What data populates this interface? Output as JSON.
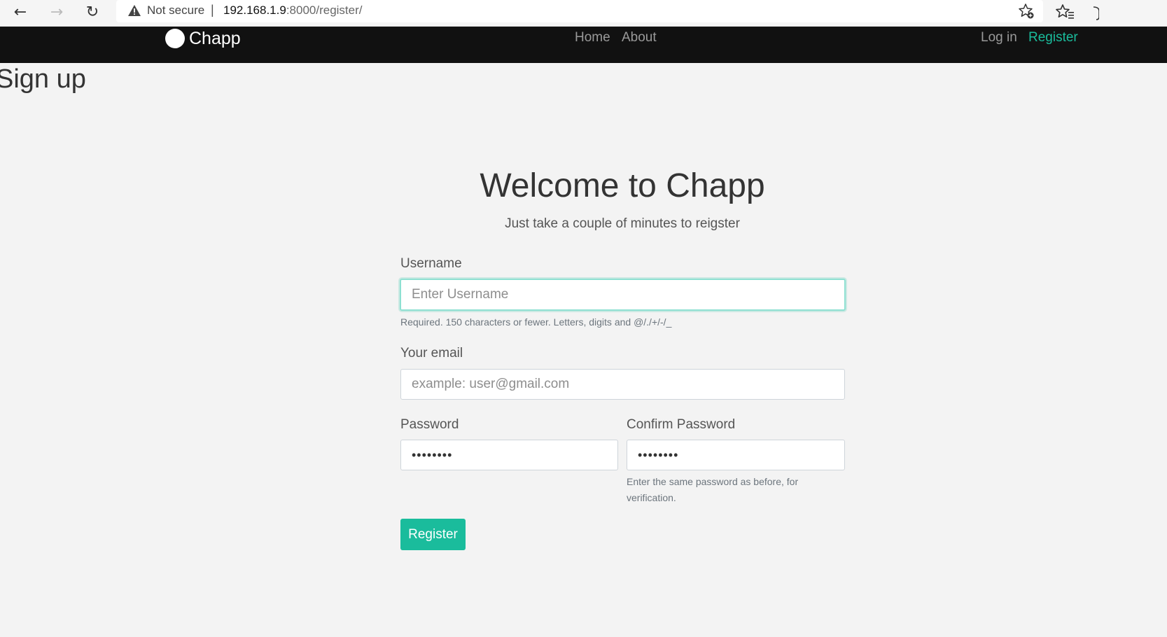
{
  "browser": {
    "back_glyph": "←",
    "forward_glyph": "→",
    "reload_glyph": "↻",
    "security_label": "Not secure",
    "url_separator": "|",
    "url_host": "192.168.1.9",
    "url_path": ":8000/register/"
  },
  "navbar": {
    "brand": "Chapp",
    "links": [
      {
        "label": "Home"
      },
      {
        "label": "About"
      }
    ],
    "auth": {
      "login": "Log in",
      "register": "Register"
    },
    "colors": {
      "background": "#111111",
      "accent": "#1abc9c"
    }
  },
  "page": {
    "title": "Sign up",
    "welcome": "Welcome to Chapp",
    "subtitle": "Just take a couple of minutes to reigster"
  },
  "form": {
    "username": {
      "label": "Username",
      "placeholder": "Enter Username",
      "help": "Required. 150 characters or fewer. Letters, digits and @/./+/-/_"
    },
    "email": {
      "label": "Your email",
      "placeholder": "example: user@gmail.com"
    },
    "password": {
      "label": "Password",
      "value": "••••••••"
    },
    "confirm_password": {
      "label": "Confirm Password",
      "value": "••••••••",
      "help_line1": "Enter the same password as before, for",
      "help_line2": "verification."
    },
    "submit_label": "Register"
  }
}
